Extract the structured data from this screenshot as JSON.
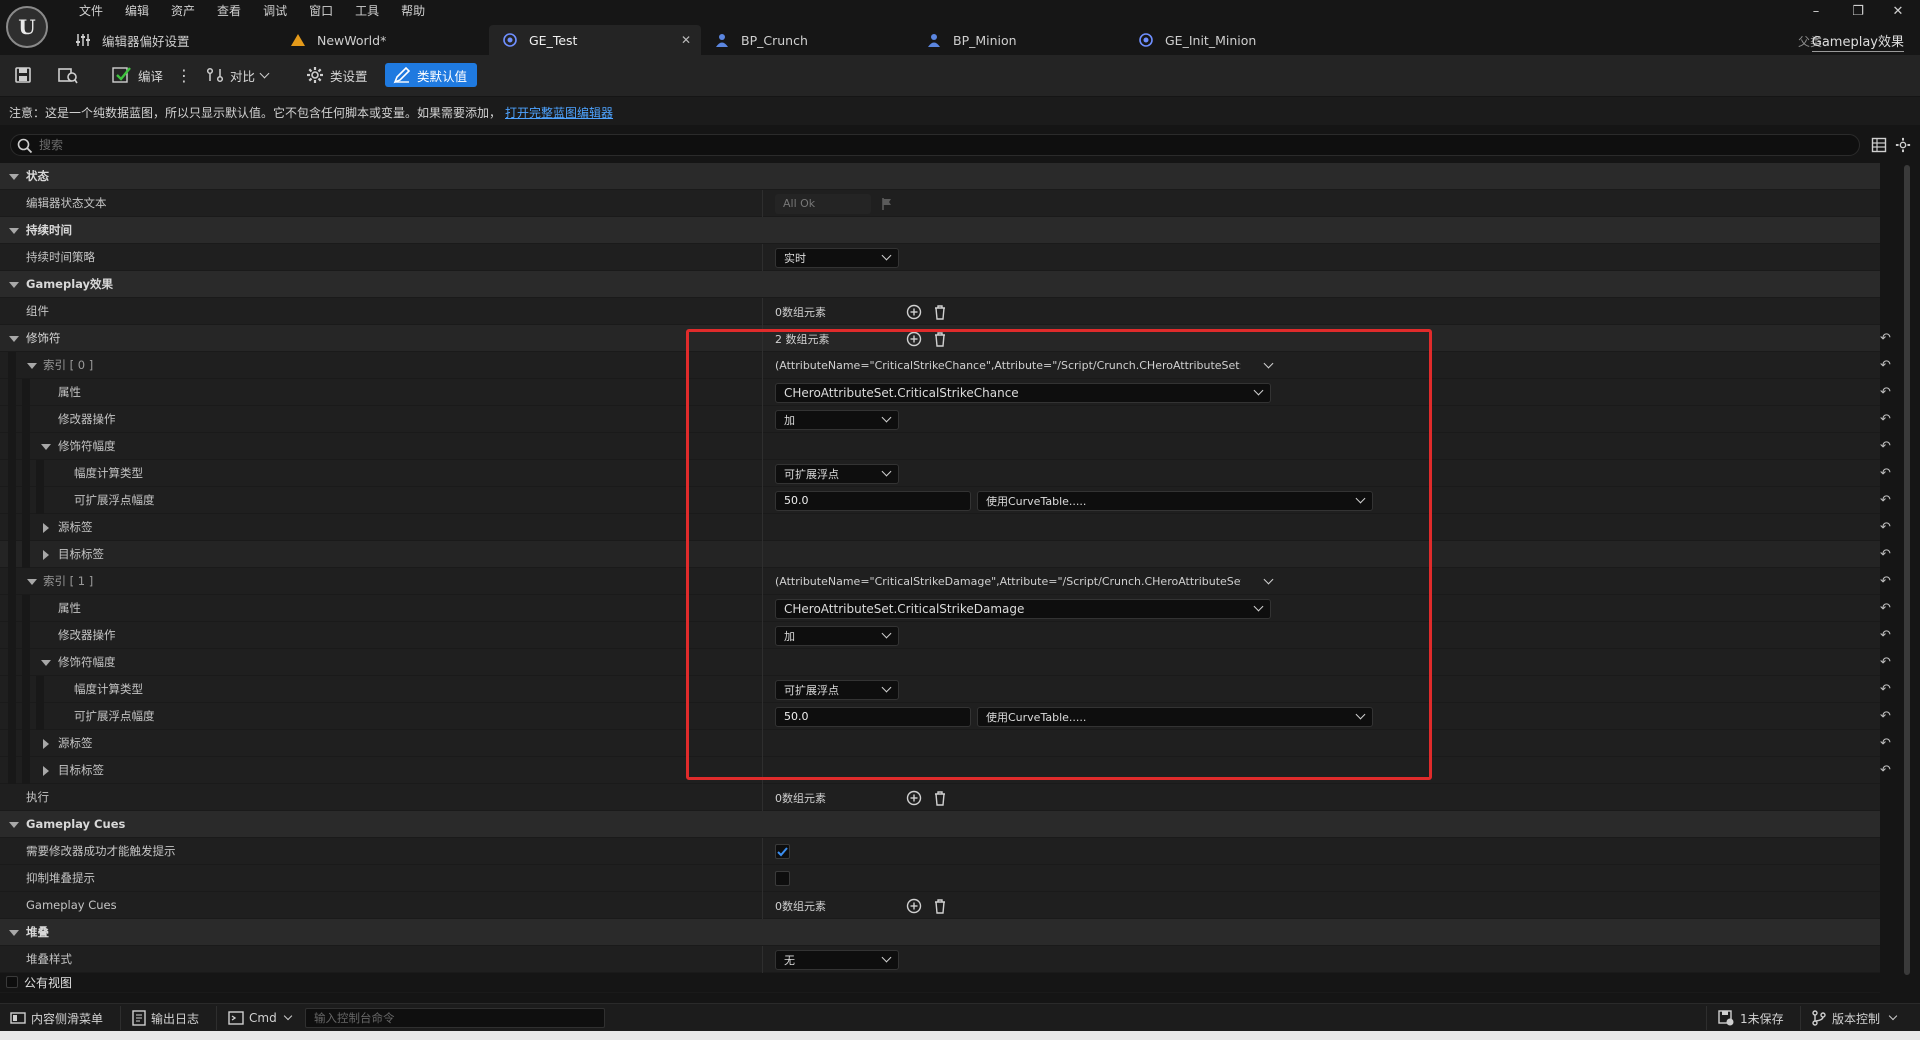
{
  "menu": [
    "文件",
    "编辑",
    "资产",
    "查看",
    "调试",
    "窗口",
    "工具",
    "帮助"
  ],
  "tabs": [
    {
      "label": "编辑器偏好设置",
      "icon": "sliders-icon"
    },
    {
      "label": "NewWorld*",
      "icon": "level-icon"
    },
    {
      "label": "GE_Test",
      "icon": "blueprint-icon",
      "active": true
    },
    {
      "label": "BP_Crunch",
      "icon": "character-icon"
    },
    {
      "label": "BP_Minion",
      "icon": "character-icon"
    },
    {
      "label": "GE_Init_Minion",
      "icon": "blueprint-icon"
    }
  ],
  "parent": {
    "label": "父类：",
    "value": "Gameplay效果"
  },
  "toolbar": {
    "compile": "编译",
    "diff": "对比",
    "class_settings": "类设置",
    "class_defaults": "类默认值"
  },
  "notice": {
    "text": "注意：这是一个纯数据蓝图，所以只显示默认值。它不包含任何脚本或变量。如果需要添加，",
    "link": "打开完整蓝图编辑器"
  },
  "search": {
    "placeholder": "搜索"
  },
  "rows": {
    "status_cat": "状态",
    "editor_status_text": "编辑器状态文本",
    "editor_status_value": "All Ok",
    "duration_cat": "持续时间",
    "duration_policy": "持续时间策略",
    "duration_policy_value": "实时",
    "gameplay_cat": "Gameplay效果",
    "components": "组件",
    "components_value": "0数组元素",
    "modifiers": "修饰符",
    "modifiers_value": "2 数组元素",
    "index0": "索引 [ 0 ]",
    "index0_value": "(AttributeName=\"CriticalStrikeChance\",Attribute=\"/Script/Crunch.CHeroAttributeSet:Critical",
    "attribute": "属性",
    "attribute0_value": "CHeroAttributeSet.CriticalStrikeChance",
    "modifier_op": "修改器操作",
    "modifier_op_value": "加",
    "modifier_magnitude": "修饰符幅度",
    "magnitude_calc_type": "幅度计算类型",
    "magnitude_calc_value": "可扩展浮点",
    "scalable_float": "可扩展浮点幅度",
    "scalable_value": "50.0",
    "curve_table": "使用CurveTable.....",
    "source_tags": "源标签",
    "target_tags": "目标标签",
    "index1": "索引 [ 1 ]",
    "index1_value": "(AttributeName=\"CriticalStrikeDamage\",Attribute=\"/Script/Crunch.CHeroAttributeSet:Critica",
    "attribute1_value": "CHeroAttributeSet.CriticalStrikeDamage",
    "executions": "执行",
    "executions_value": "0数组元素",
    "cues_cat": "Gameplay Cues",
    "require_modifier_success": "需要修改器成功才能触发提示",
    "suppress_stacking": "抑制堆叠提示",
    "gameplay_cues": "Gameplay Cues",
    "gameplay_cues_value": "0数组元素",
    "stacking_cat": "堆叠",
    "stacking_type": "堆叠样式",
    "stacking_type_value": "无",
    "public_view": "公有视图"
  },
  "checkboxes": {
    "require_modifier_success": true,
    "suppress_stacking": false
  },
  "bottombar": {
    "content_drawer": "内容侧滑菜单",
    "output_log": "输出日志",
    "cmd": "Cmd",
    "cmd_placeholder": "输入控制台命令",
    "unsaved": "1未保存",
    "source_control": "版本控制"
  },
  "colors": {
    "accent": "#1f7ae0",
    "highlight": "#e02b2b",
    "link": "#4ea3ff"
  }
}
